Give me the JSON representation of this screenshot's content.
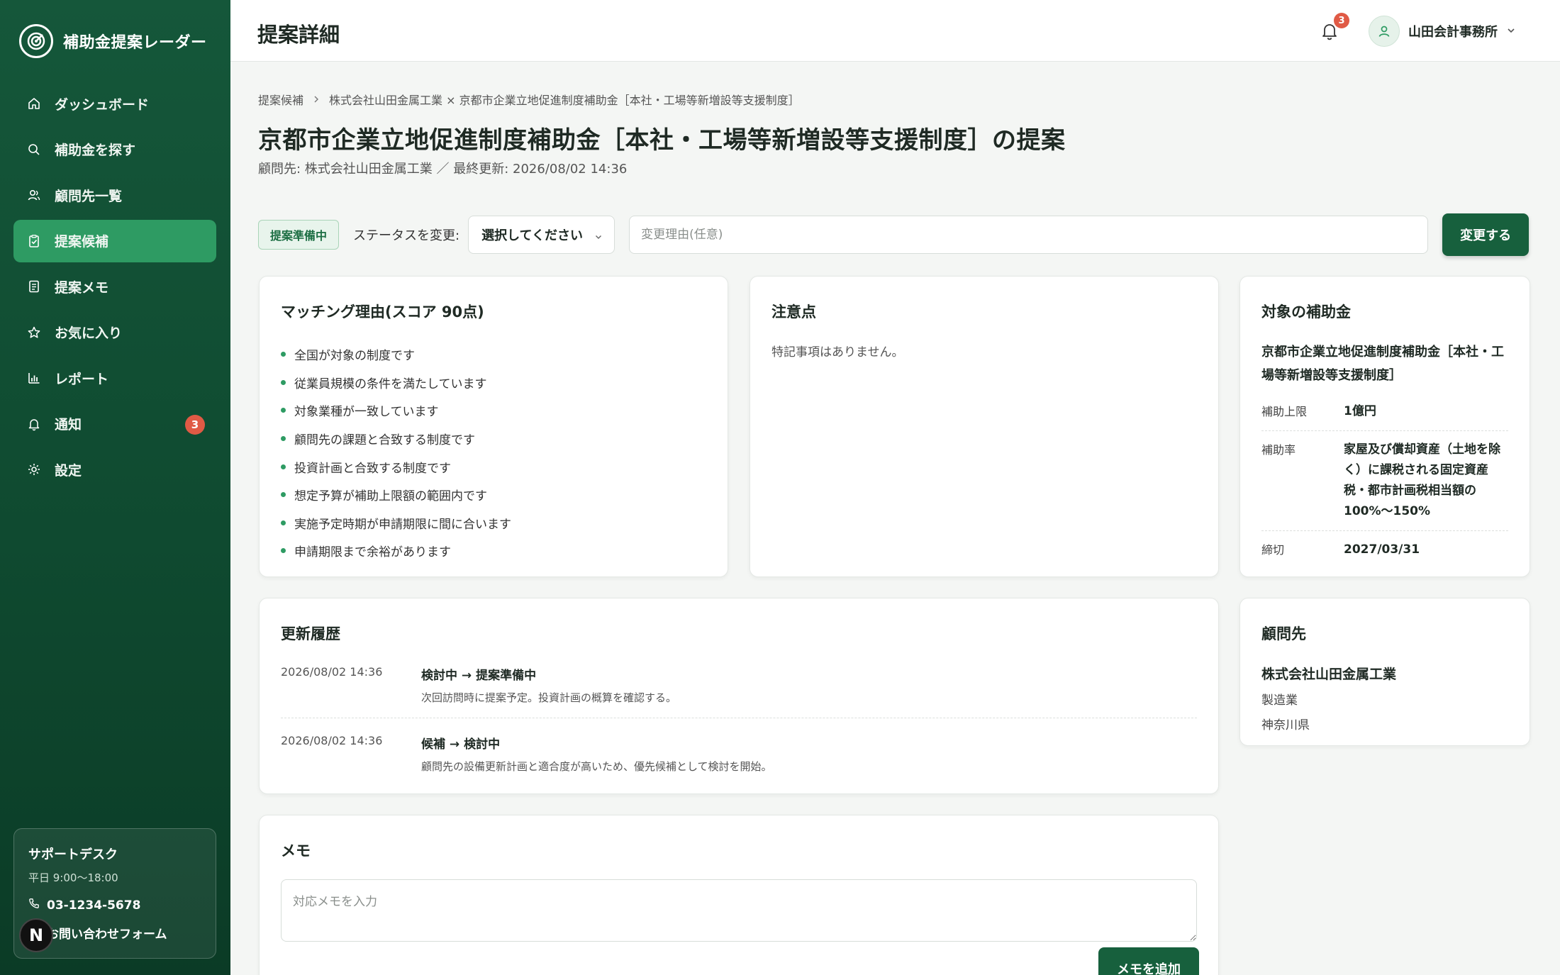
{
  "brand": {
    "name": "補助金提案レーダー"
  },
  "sidebar": {
    "items": [
      {
        "label": "ダッシュボード"
      },
      {
        "label": "補助金を探す"
      },
      {
        "label": "顧問先一覧"
      },
      {
        "label": "提案候補"
      },
      {
        "label": "提案メモ"
      },
      {
        "label": "お気に入り"
      },
      {
        "label": "レポート"
      },
      {
        "label": "通知",
        "badge": "3"
      },
      {
        "label": "設定"
      }
    ],
    "active_index": 3,
    "support": {
      "title": "サポートデスク",
      "hours": "平日 9:00〜18:00",
      "phone": "03-1234-5678",
      "form": "お問い合わせフォーム"
    },
    "n_badge": "N"
  },
  "topbar": {
    "title": "提案詳細",
    "notification_count": "3",
    "user_name": "山田会計事務所"
  },
  "breadcrumb": {
    "root": "提案候補",
    "current": "株式会社山田金属工業 × 京都市企業立地促進制度補助金［本社・工場等新増設等支援制度］"
  },
  "page": {
    "title": "京都市企業立地促進制度補助金［本社・工場等新増設等支援制度］の提案",
    "meta": "顧問先: 株式会社山田金属工業 ／ 最終更新: 2026/08/02 14:36"
  },
  "status": {
    "current": "提案準備中",
    "change_label": "ステータスを変更:",
    "select_value": "選択してください",
    "reason_placeholder": "変更理由(任意)",
    "submit_label": "変更する"
  },
  "matching": {
    "title": "マッチング理由(スコア 90点)",
    "reasons": [
      "全国が対象の制度です",
      "従業員規模の条件を満たしています",
      "対象業種が一致しています",
      "顧問先の課題と合致する制度です",
      "投資計画と合致する制度です",
      "想定予算が補助上限額の範囲内です",
      "実施予定時期が申請期限に間に合います",
      "申請期限まで余裕があります"
    ]
  },
  "caution": {
    "title": "注意点",
    "text": "特記事項はありません。"
  },
  "subsidy": {
    "title": "対象の補助金",
    "name": "京都市企業立地促進制度補助金［本社・工場等新増設等支援制度］",
    "fields": [
      {
        "key": "補助上限",
        "value": "1億円"
      },
      {
        "key": "補助率",
        "value": "家屋及び償却資産（土地を除く）に課税される固定資産税・都市計画税相当額の100%〜150%"
      },
      {
        "key": "締切",
        "value": "2027/03/31"
      }
    ]
  },
  "history": {
    "title": "更新履歴",
    "items": [
      {
        "date": "2026/08/02 14:36",
        "change": "検討中 → 提案準備中",
        "note": "次回訪問時に提案予定。投資計画の概算を確認する。"
      },
      {
        "date": "2026/08/02 14:36",
        "change": "候補 → 検討中",
        "note": "顧問先の設備更新計画と適合度が高いため、優先候補として検討を開始。"
      }
    ]
  },
  "client": {
    "title": "顧問先",
    "name": "株式会社山田金属工業",
    "industry": "製造業",
    "region": "神奈川県"
  },
  "memo": {
    "title": "メモ",
    "placeholder": "対応メモを入力",
    "submit_label": "メモを追加"
  }
}
